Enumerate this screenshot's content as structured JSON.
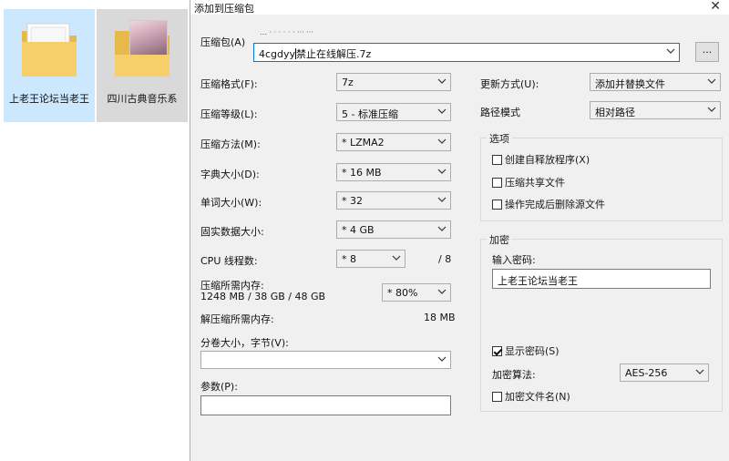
{
  "explorer": {
    "files": [
      {
        "label": "上老王论坛当老王",
        "type": "folder",
        "selected": true
      },
      {
        "label": "四川古典音乐系",
        "type": "folder-with-photo",
        "selected": false
      }
    ]
  },
  "dialog": {
    "title": "添加到压缩包",
    "archive": {
      "label": "压缩包(A)",
      "path_hint": "…  · · · ·  ·  ·  ··· ···",
      "value_before_cursor": "4cgdyy",
      "value_after_cursor": "禁止在线解压.7z",
      "browse_label": "..."
    },
    "left": {
      "format": {
        "label": "压缩格式(F):",
        "value": "7z"
      },
      "level": {
        "label": "压缩等级(L):",
        "value": "5 - 标准压缩"
      },
      "method": {
        "label": "压缩方法(M):",
        "value": "* LZMA2"
      },
      "dict": {
        "label": "字典大小(D):",
        "value": "* 16 MB"
      },
      "word": {
        "label": "单词大小(W):",
        "value": "* 32"
      },
      "solid": {
        "label": "固实数据大小:",
        "value": "* 4 GB"
      },
      "cpu": {
        "label": "CPU 线程数:",
        "value": "* 8",
        "max": "/ 8"
      },
      "mem_compress": {
        "label": "压缩所需内存:",
        "detail": "1248 MB / 38 GB / 48 GB",
        "value": "* 80%"
      },
      "mem_decompress": {
        "label": "解压缩所需内存:",
        "value": "18 MB"
      },
      "volume": {
        "label": "分卷大小，字节(V):",
        "value": ""
      },
      "params": {
        "label": "参数(P):",
        "value": ""
      }
    },
    "right": {
      "update": {
        "label": "更新方式(U):",
        "value": "添加并替换文件"
      },
      "path_mode": {
        "label": "路径模式",
        "value": "相对路径"
      },
      "options": {
        "title": "选项",
        "items": [
          {
            "label": "创建自释放程序(X)",
            "checked": false
          },
          {
            "label": "压缩共享文件",
            "checked": false
          },
          {
            "label": "操作完成后删除源文件",
            "checked": false
          }
        ]
      },
      "encryption": {
        "title": "加密",
        "password_label": "输入密码:",
        "password_value": "上老王论坛当老王",
        "show_password": {
          "label": "显示密码(S)",
          "checked": true
        },
        "algorithm_label": "加密算法:",
        "algorithm_value": "AES-256",
        "encrypt_names": {
          "label": "加密文件名(N)",
          "checked": false
        }
      }
    }
  }
}
